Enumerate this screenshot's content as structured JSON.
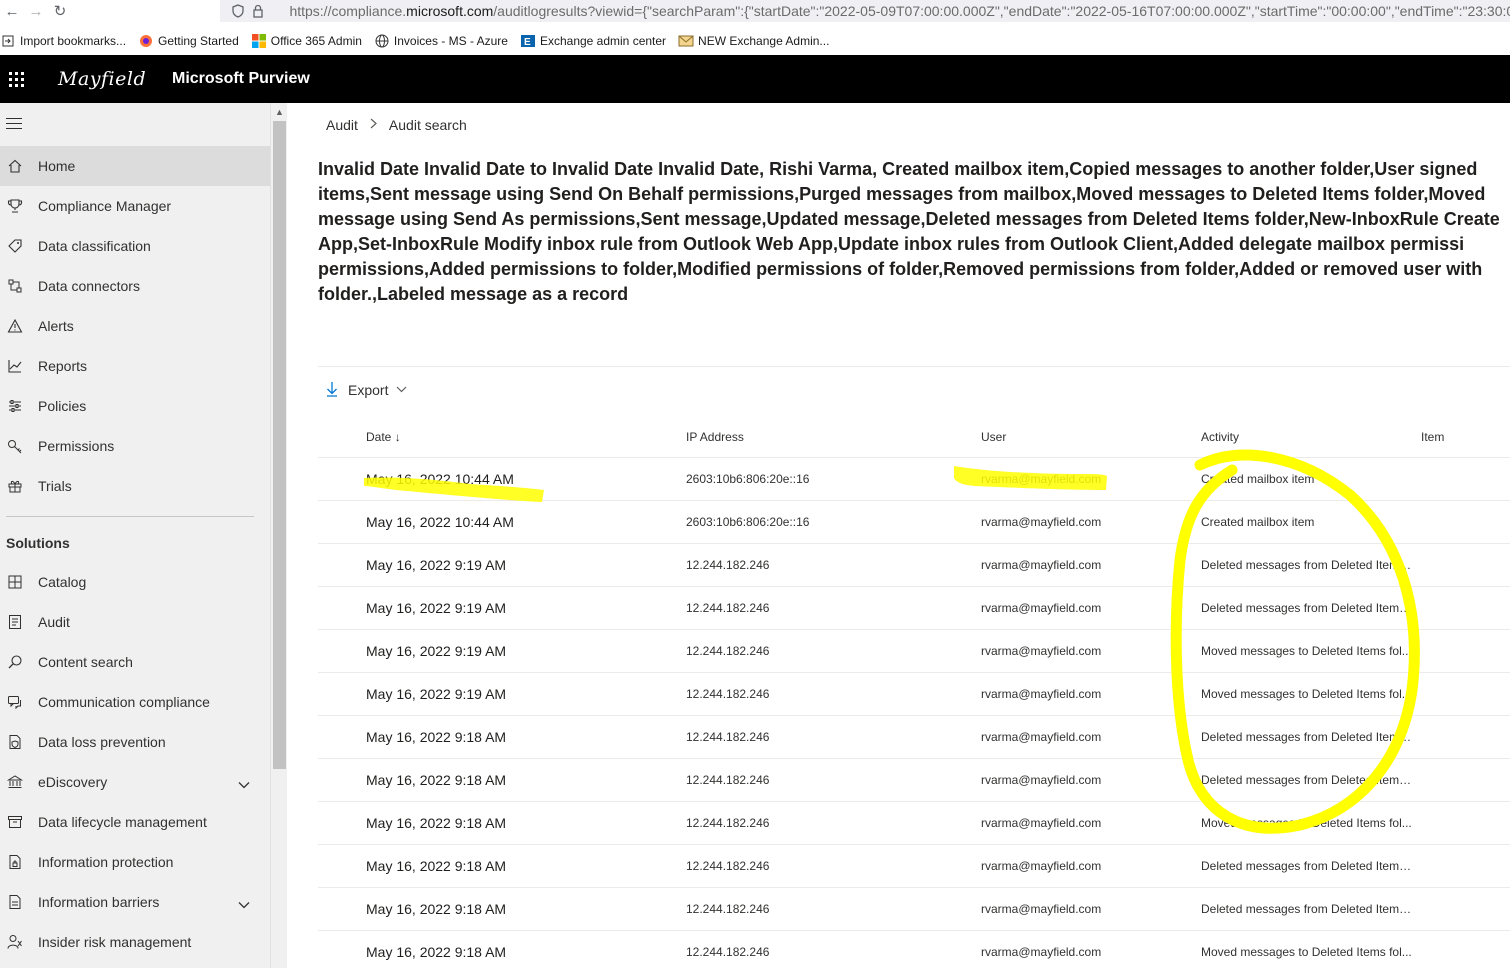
{
  "browser": {
    "url_prefix": "https://compliance.",
    "url_domain": "microsoft.com",
    "url_rest": "/auditlogresults?viewid={\"searchParam\":{\"startDate\":\"2022-05-09T07:00:00.000Z\",\"endDate\":\"2022-05-16T07:00:00.000Z\",\"startTime\":\"00:00:00\",\"endTime\":\"23:30:00\"",
    "bookmarks": [
      {
        "label": "Import bookmarks...",
        "icon": "import-icon"
      },
      {
        "label": "Getting Started",
        "icon": "firefox-icon"
      },
      {
        "label": "Office 365 Admin",
        "icon": "microsoft-logo-icon"
      },
      {
        "label": "Invoices - MS - Azure",
        "icon": "globe-icon"
      },
      {
        "label": "Exchange admin center",
        "icon": "exchange-icon"
      },
      {
        "label": "NEW Exchange Admin...",
        "icon": "envelope-icon"
      }
    ]
  },
  "header": {
    "logo_text": "Mayfield",
    "app_title": "Microsoft Purview"
  },
  "sidebar": {
    "items": [
      {
        "label": "Home",
        "icon": "home-icon",
        "active": true
      },
      {
        "label": "Compliance Manager",
        "icon": "trophy-icon"
      },
      {
        "label": "Data classification",
        "icon": "tag-icon"
      },
      {
        "label": "Data connectors",
        "icon": "connector-icon"
      },
      {
        "label": "Alerts",
        "icon": "warning-icon"
      },
      {
        "label": "Reports",
        "icon": "chart-line-icon"
      },
      {
        "label": "Policies",
        "icon": "sliders-icon"
      },
      {
        "label": "Permissions",
        "icon": "key-icon"
      },
      {
        "label": "Trials",
        "icon": "gift-icon"
      }
    ],
    "solutions_heading": "Solutions",
    "solutions": [
      {
        "label": "Catalog",
        "icon": "catalog-icon"
      },
      {
        "label": "Audit",
        "icon": "audit-icon"
      },
      {
        "label": "Content search",
        "icon": "search-icon"
      },
      {
        "label": "Communication compliance",
        "icon": "chat-icon"
      },
      {
        "label": "Data loss prevention",
        "icon": "shield-doc-icon"
      },
      {
        "label": "eDiscovery",
        "icon": "bank-icon",
        "expandable": true
      },
      {
        "label": "Data lifecycle management",
        "icon": "archive-icon"
      },
      {
        "label": "Information protection",
        "icon": "lock-doc-icon"
      },
      {
        "label": "Information barriers",
        "icon": "barrier-icon",
        "expandable": true
      },
      {
        "label": "Insider risk management",
        "icon": "person-icon"
      }
    ]
  },
  "breadcrumb": {
    "root": "Audit",
    "current": "Audit search"
  },
  "search_title_lines": [
    "Invalid Date Invalid Date to Invalid Date Invalid Date, Rishi Varma, Created mailbox item,Copied messages to another folder,User signed",
    "items,Sent message using Send On Behalf permissions,Purged messages from mailbox,Moved messages to Deleted Items folder,Moved",
    "message using Send As permissions,Sent message,Updated message,Deleted messages from Deleted Items folder,New-InboxRule Create",
    "App,Set-InboxRule Modify inbox rule from Outlook Web App,Update inbox rules from Outlook Client,Added delegate mailbox permissi",
    "permissions,Added permissions to folder,Modified permissions of folder,Removed permissions from folder,Added or removed user with",
    "folder.,Labeled message as a record"
  ],
  "toolbar": {
    "export_label": "Export"
  },
  "table": {
    "columns": [
      "Date",
      "IP Address",
      "User",
      "Activity",
      "Item"
    ],
    "sort_indicator": "↓",
    "rows": [
      {
        "date": "May 16, 2022 10:44 AM",
        "ip": "2603:10b6:806:20e::16",
        "user": "rvarma@mayfield.com",
        "activity": "Created mailbox item"
      },
      {
        "date": "May 16, 2022 10:44 AM",
        "ip": "2603:10b6:806:20e::16",
        "user": "rvarma@mayfield.com",
        "activity": "Created mailbox item"
      },
      {
        "date": "May 16, 2022 9:19 AM",
        "ip": "12.244.182.246",
        "user": "rvarma@mayfield.com",
        "activity": "Deleted messages from Deleted Items ..."
      },
      {
        "date": "May 16, 2022 9:19 AM",
        "ip": "12.244.182.246",
        "user": "rvarma@mayfield.com",
        "activity": "Deleted messages from Deleted Items ..."
      },
      {
        "date": "May 16, 2022 9:19 AM",
        "ip": "12.244.182.246",
        "user": "rvarma@mayfield.com",
        "activity": "Moved messages to Deleted Items fol..."
      },
      {
        "date": "May 16, 2022 9:19 AM",
        "ip": "12.244.182.246",
        "user": "rvarma@mayfield.com",
        "activity": "Moved messages to Deleted Items fol..."
      },
      {
        "date": "May 16, 2022 9:18 AM",
        "ip": "12.244.182.246",
        "user": "rvarma@mayfield.com",
        "activity": "Deleted messages from Deleted Items ..."
      },
      {
        "date": "May 16, 2022 9:18 AM",
        "ip": "12.244.182.246",
        "user": "rvarma@mayfield.com",
        "activity": "Deleted messages from Deleted Items ..."
      },
      {
        "date": "May 16, 2022 9:18 AM",
        "ip": "12.244.182.246",
        "user": "rvarma@mayfield.com",
        "activity": "Moved messages to Deleted Items fol..."
      },
      {
        "date": "May 16, 2022 9:18 AM",
        "ip": "12.244.182.246",
        "user": "rvarma@mayfield.com",
        "activity": "Deleted messages from Deleted Items ..."
      },
      {
        "date": "May 16, 2022 9:18 AM",
        "ip": "12.244.182.246",
        "user": "rvarma@mayfield.com",
        "activity": "Deleted messages from Deleted Items ..."
      },
      {
        "date": "May 16, 2022 9:18 AM",
        "ip": "12.244.182.246",
        "user": "rvarma@mayfield.com",
        "activity": "Moved messages to Deleted Items fol..."
      }
    ]
  },
  "colors": {
    "suite_header": "#000000",
    "sidebar_bg": "#f0f0f0",
    "accent": "#0078d4",
    "highlighter": "#ffff00"
  }
}
